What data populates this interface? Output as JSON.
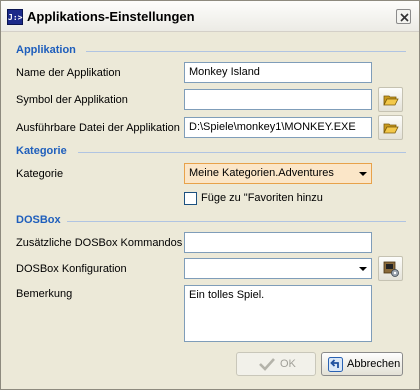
{
  "window": {
    "title": "Applikations-Einstellungen",
    "icon_text": "J:>"
  },
  "sections": {
    "application": "Applikation",
    "category": "Kategorie",
    "dosbox": "DOSBox"
  },
  "app": {
    "name_label": "Name der Applikation",
    "name_value": "Monkey Island",
    "symbol_label": "Symbol der Applikation",
    "symbol_value": "",
    "exe_label": "Ausführbare Datei der Applikation",
    "exe_value": "D:\\Spiele\\monkey1\\MONKEY.EXE"
  },
  "category": {
    "label": "Kategorie",
    "selected": "Meine Kategorien.Adventures",
    "favorites_label": "Füge zu \"Favoriten hinzu",
    "favorites_checked": false
  },
  "dosbox": {
    "commands_label": "Zusätzliche DOSBox Kommandos",
    "commands_value": "",
    "config_label": "DOSBox Konfiguration",
    "config_selected": "",
    "remark_label": "Bemerkung",
    "remark_value": "Ein tolles Spiel."
  },
  "buttons": {
    "ok": "OK",
    "cancel": "Abbrechen"
  },
  "colors": {
    "section": "#1e5ebc",
    "folder": "#e8b028",
    "accent_focus": "#e8a24a"
  },
  "icons": [
    "folder-open-icon",
    "folder-open-icon",
    "dosbox-config-icon",
    "check-icon",
    "undo-arrow-icon",
    "close-icon"
  ]
}
